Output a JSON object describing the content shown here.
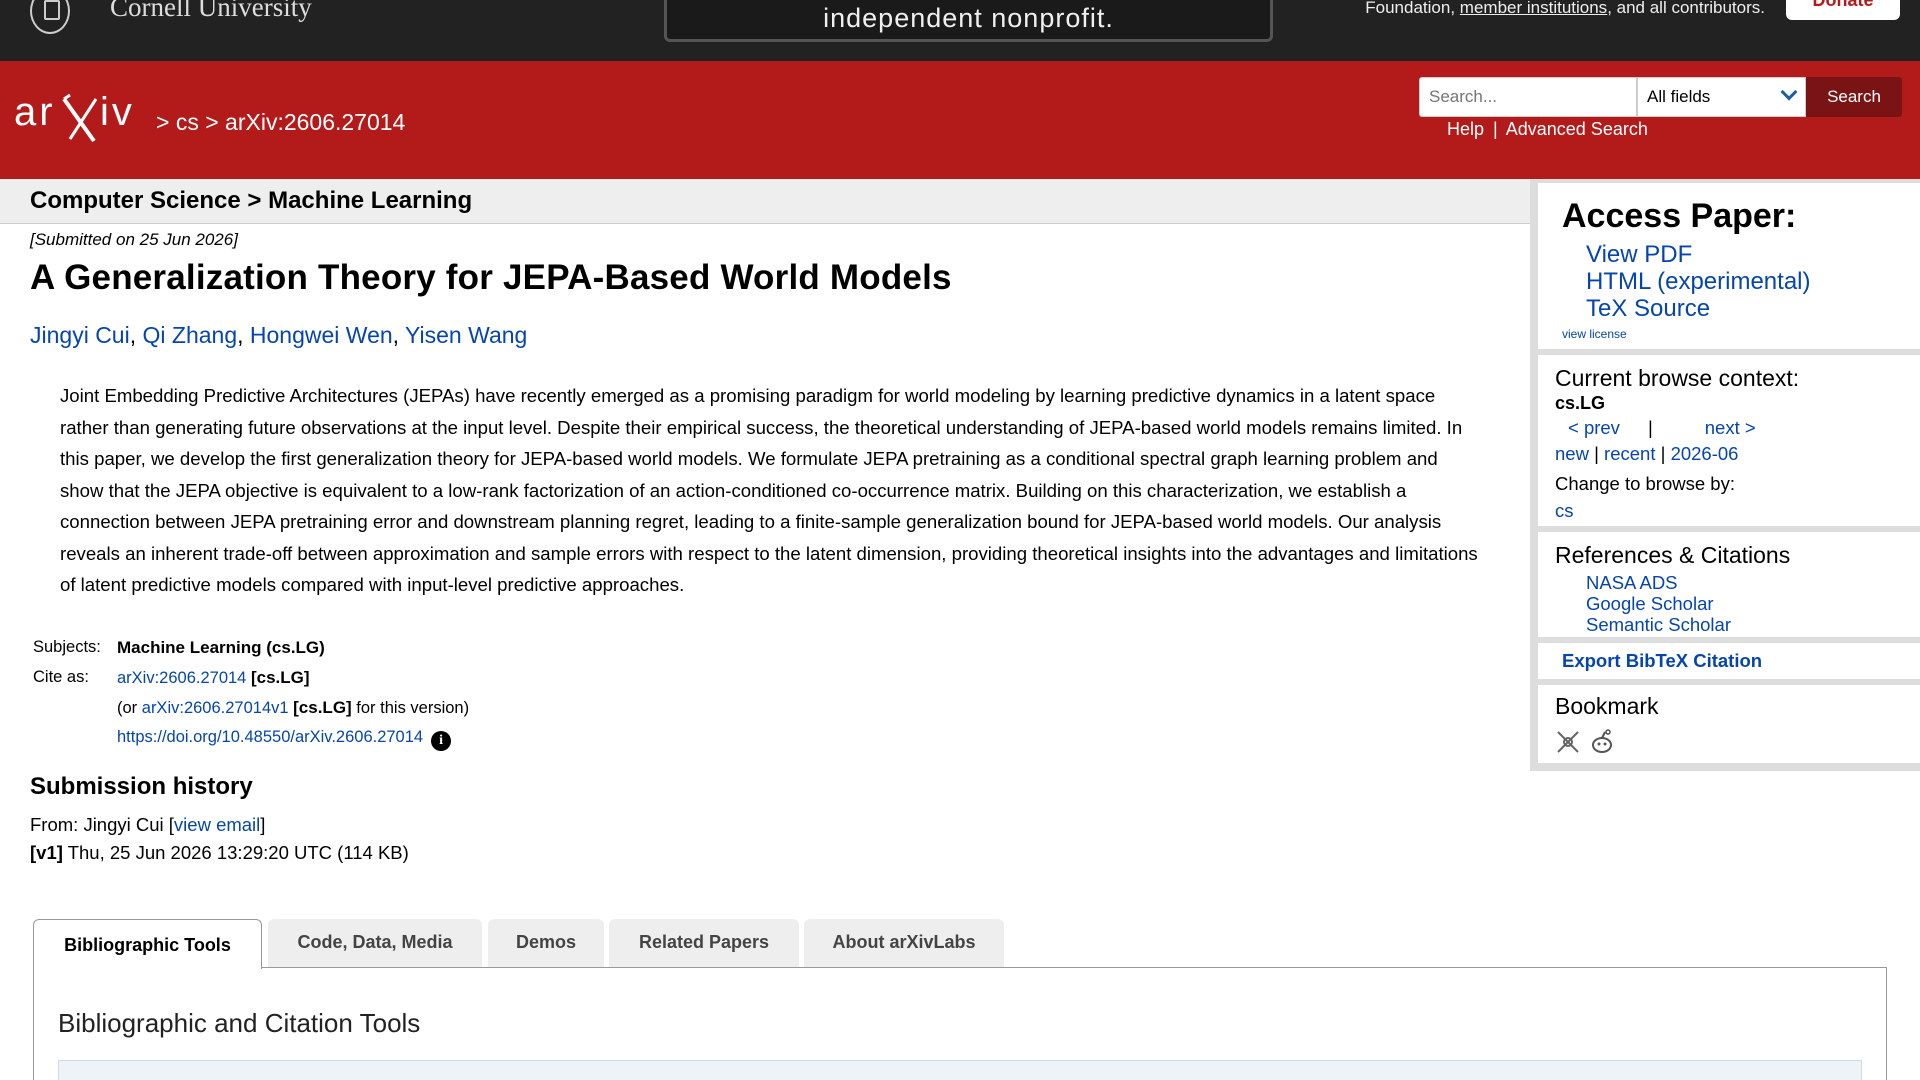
{
  "top": {
    "cornell_name": "Cornell University",
    "banner_text": "independent nonprofit.",
    "funding_prefix": "Foundation,",
    "funding_link": "member institutions",
    "funding_suffix": ", and all contributors.",
    "donate_label": "Donate"
  },
  "header": {
    "breadcrumb_sep1": ">",
    "breadcrumb_cs": "cs",
    "breadcrumb_sep2": ">",
    "breadcrumb_id": "arXiv:2606.27014",
    "search_placeholder": "Search...",
    "search_field": "All fields",
    "search_button": "Search",
    "help_link": "Help",
    "links_sep": "|",
    "advanced_link": "Advanced Search"
  },
  "paper": {
    "subject_crumb_main": "Computer Science",
    "subject_crumb_sep": ">",
    "subject_crumb_sub": "Machine Learning",
    "submitted": "[Submitted on 25 Jun 2026]",
    "title": "A Generalization Theory for JEPA-Based World Models",
    "authors": [
      "Jingyi Cui",
      "Qi Zhang",
      "Hongwei Wen",
      "Yisen Wang"
    ],
    "abstract": "Joint Embedding Predictive Architectures (JEPAs) have recently emerged as a promising paradigm for world modeling by learning predictive dynamics in a latent space rather than generating future observations at the input level. Despite their empirical success, the theoretical understanding of JEPA-based world models remains limited. In this paper, we develop the first generalization theory for JEPA-based world models. We formulate JEPA pretraining as a conditional spectral graph learning problem and show that the JEPA objective is equivalent to a low-rank factorization of an action-conditioned co-occurrence matrix. Building on this characterization, we establish a connection between JEPA pretraining error and downstream planning regret, leading to a finite-sample generalization bound for JEPA-based world models. Our analysis reveals an inherent trade-off between approximation and sample errors with respect to the latent dimension, providing theoretical insights into the advantages and limitations of latent predictive models compared with input-level predictive approaches.",
    "subjects_label": "Subjects:",
    "subjects_value": "Machine Learning (cs.LG)",
    "cite_label": "Cite as:",
    "cite_id": "arXiv:2606.27014",
    "cite_cat": "[cs.LG]",
    "cite_or_prefix": "(or",
    "cite_version_id": "arXiv:2606.27014v1",
    "cite_version_cat": "[cs.LG]",
    "cite_version_suffix": "for this version)",
    "doi": "https://doi.org/10.48550/arXiv.2606.27014",
    "info_icon": "i"
  },
  "history": {
    "heading": "Submission history",
    "from_prefix": "From: Jingyi Cui [",
    "view_email": "view email",
    "from_suffix": "]",
    "v1_tag": "[v1]",
    "v1_text": "Thu, 25 Jun 2026 13:29:20 UTC (114 KB)"
  },
  "tabs": [
    {
      "label": "Bibliographic Tools",
      "active": true
    },
    {
      "label": "Code, Data, Media",
      "active": false
    },
    {
      "label": "Demos",
      "active": false
    },
    {
      "label": "Related Papers",
      "active": false
    },
    {
      "label": "About arXivLabs",
      "active": false
    }
  ],
  "panel": {
    "heading": "Bibliographic and Citation Tools"
  },
  "sidebar": {
    "access_title": "Access Paper:",
    "access_links": [
      "View PDF",
      "HTML (experimental)",
      "TeX Source"
    ],
    "view_license": "view license",
    "context_title": "Current browse context:",
    "context_cat": "cs.LG",
    "prev": "< prev",
    "nav_sep": "|",
    "next": "next >",
    "new": "new",
    "recent": "recent",
    "month": "2026-06",
    "change_browse": "Change to browse by:",
    "browse_cs": "cs",
    "refs_title": "References & Citations",
    "ref_links": [
      "NASA ADS",
      "Google Scholar",
      "Semantic Scholar"
    ],
    "bibtex": "Export BibTeX Citation",
    "bookmark_title": "Bookmark",
    "bookmark_icons": [
      "bibsonomy-icon",
      "reddit-icon"
    ]
  },
  "colors": {
    "arxiv_red": "#b31b1b",
    "link_blue": "#0645ad",
    "dark_bar": "#222222"
  }
}
